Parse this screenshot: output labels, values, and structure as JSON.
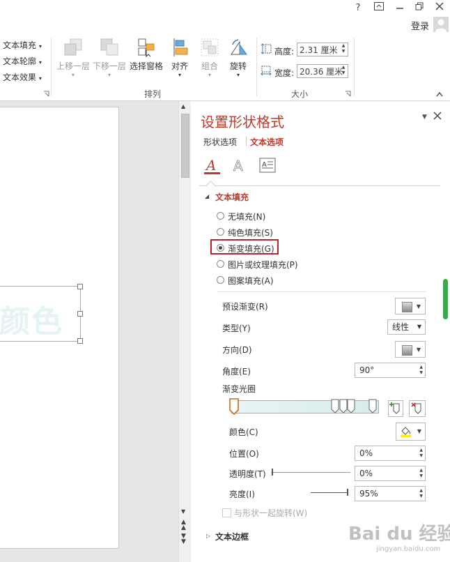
{
  "window": {
    "help": "?",
    "login": "登录"
  },
  "ribbon": {
    "text_fill": "文本填充",
    "text_outline": "文本轮廓",
    "text_effect": "文本效果",
    "bring_forward": "上移一层",
    "send_backward": "下移一层",
    "selection_pane": "选择窗格",
    "align": "对齐",
    "group": "组合",
    "rotate": "旋转",
    "arrange_group": "排列",
    "height_label": "高度:",
    "height_value": "2.31 厘米",
    "width_label": "宽度:",
    "width_value": "20.36 厘米",
    "size_group": "大小"
  },
  "slide": {
    "text": "颜色"
  },
  "pane": {
    "title": "设置形状格式",
    "tab_shape": "形状选项",
    "tab_text": "文本选项",
    "section_fill": "文本填充",
    "fill_options": [
      "无填充(N)",
      "纯色填充(S)",
      "渐变填充(G)",
      "图片或纹理填充(P)",
      "图案填充(A)"
    ],
    "selected_fill": "渐变填充(G)",
    "preset_label": "预设渐变(R)",
    "type_label": "类型(Y)",
    "type_value": "线性",
    "direction_label": "方向(D)",
    "angle_label": "角度(E)",
    "angle_value": "90°",
    "stops_label": "渐变光圈",
    "color_label": "颜色(C)",
    "position_label": "位置(O)",
    "position_value": "0%",
    "transparency_label": "透明度(T)",
    "transparency_value": "0%",
    "brightness_label": "亮度(I)",
    "brightness_value": "95%",
    "rotate_with_shape": "与形状一起旋转(W)",
    "section_border": "文本边框"
  },
  "watermark": {
    "text": "Bai du 经验",
    "sub": "jingyan.baidu.com"
  },
  "colors": {
    "accent": "#c0392b",
    "highlight_box": "#c0202a",
    "slide_text": "#e4f3f3",
    "scroll_green": "#3aa94b"
  }
}
